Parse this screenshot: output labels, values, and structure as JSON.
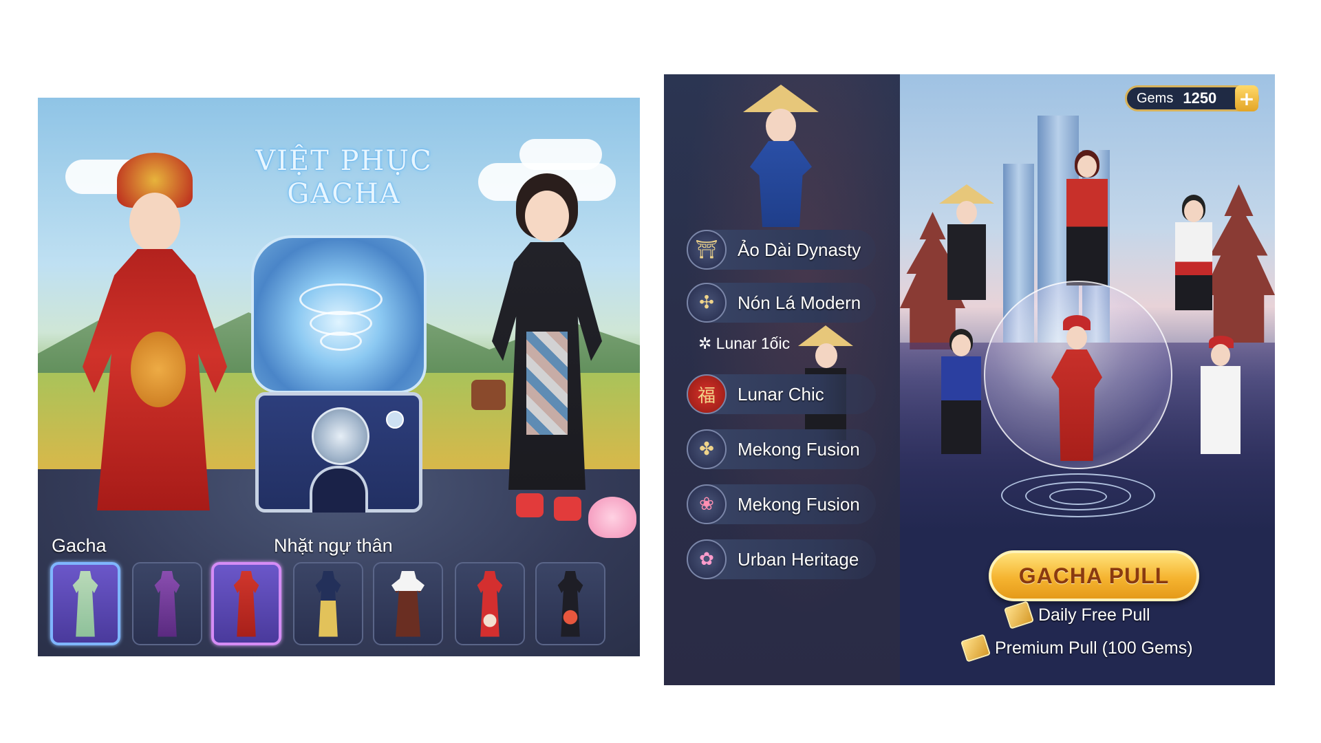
{
  "left_panel": {
    "title_line1": "VIỆT PHỤC",
    "title_line2": "GACHA",
    "gacha_label": "Gacha",
    "collection_label": "Nhặt ngự thân",
    "outfits": [
      {
        "name": "green-aodai-icon",
        "color": "#8ec19a",
        "state": "selected"
      },
      {
        "name": "purple-aodai-icon",
        "color": "#6a3a8c",
        "state": "normal"
      },
      {
        "name": "red-dragon-robe-icon",
        "color": "#c0302a",
        "state": "selected"
      },
      {
        "name": "navy-gold-aodai-icon",
        "color": "#23305a",
        "state": "normal"
      },
      {
        "name": "brown-skirt-outfit-icon",
        "color": "#6a2e22",
        "state": "normal"
      },
      {
        "name": "red-floral-aodai-icon",
        "color": "#d42f2f",
        "state": "normal"
      },
      {
        "name": "black-floral-aodai-icon",
        "color": "#1e1e26",
        "state": "normal"
      }
    ]
  },
  "right_panel": {
    "gems": {
      "label": "Gems",
      "value": "1250",
      "plus": "+"
    },
    "menu": [
      {
        "label": "Ảo Dài Dynasty",
        "icon": "⛩"
      },
      {
        "label": "Nón Lá Modern",
        "icon": "✣"
      },
      {
        "label": "Lunar Chic",
        "icon": "福"
      },
      {
        "label": "Mekong Fusion",
        "icon": "✤"
      },
      {
        "label": "Mekong Fusion",
        "icon": "❀"
      },
      {
        "label": "Urban Heritage",
        "icon": "✿"
      }
    ],
    "sub_item": {
      "icon": "✲",
      "label": "Lunar 1ốic"
    },
    "pull_button": "GACHA PULL",
    "daily_pull": "Daily Free Pull",
    "premium_pull": "Premium Pull (100 Gems)"
  },
  "colors": {
    "gold": "#f5b430",
    "panel_dark": "#2a2f4a",
    "accent_blue": "#7fb6ff"
  }
}
